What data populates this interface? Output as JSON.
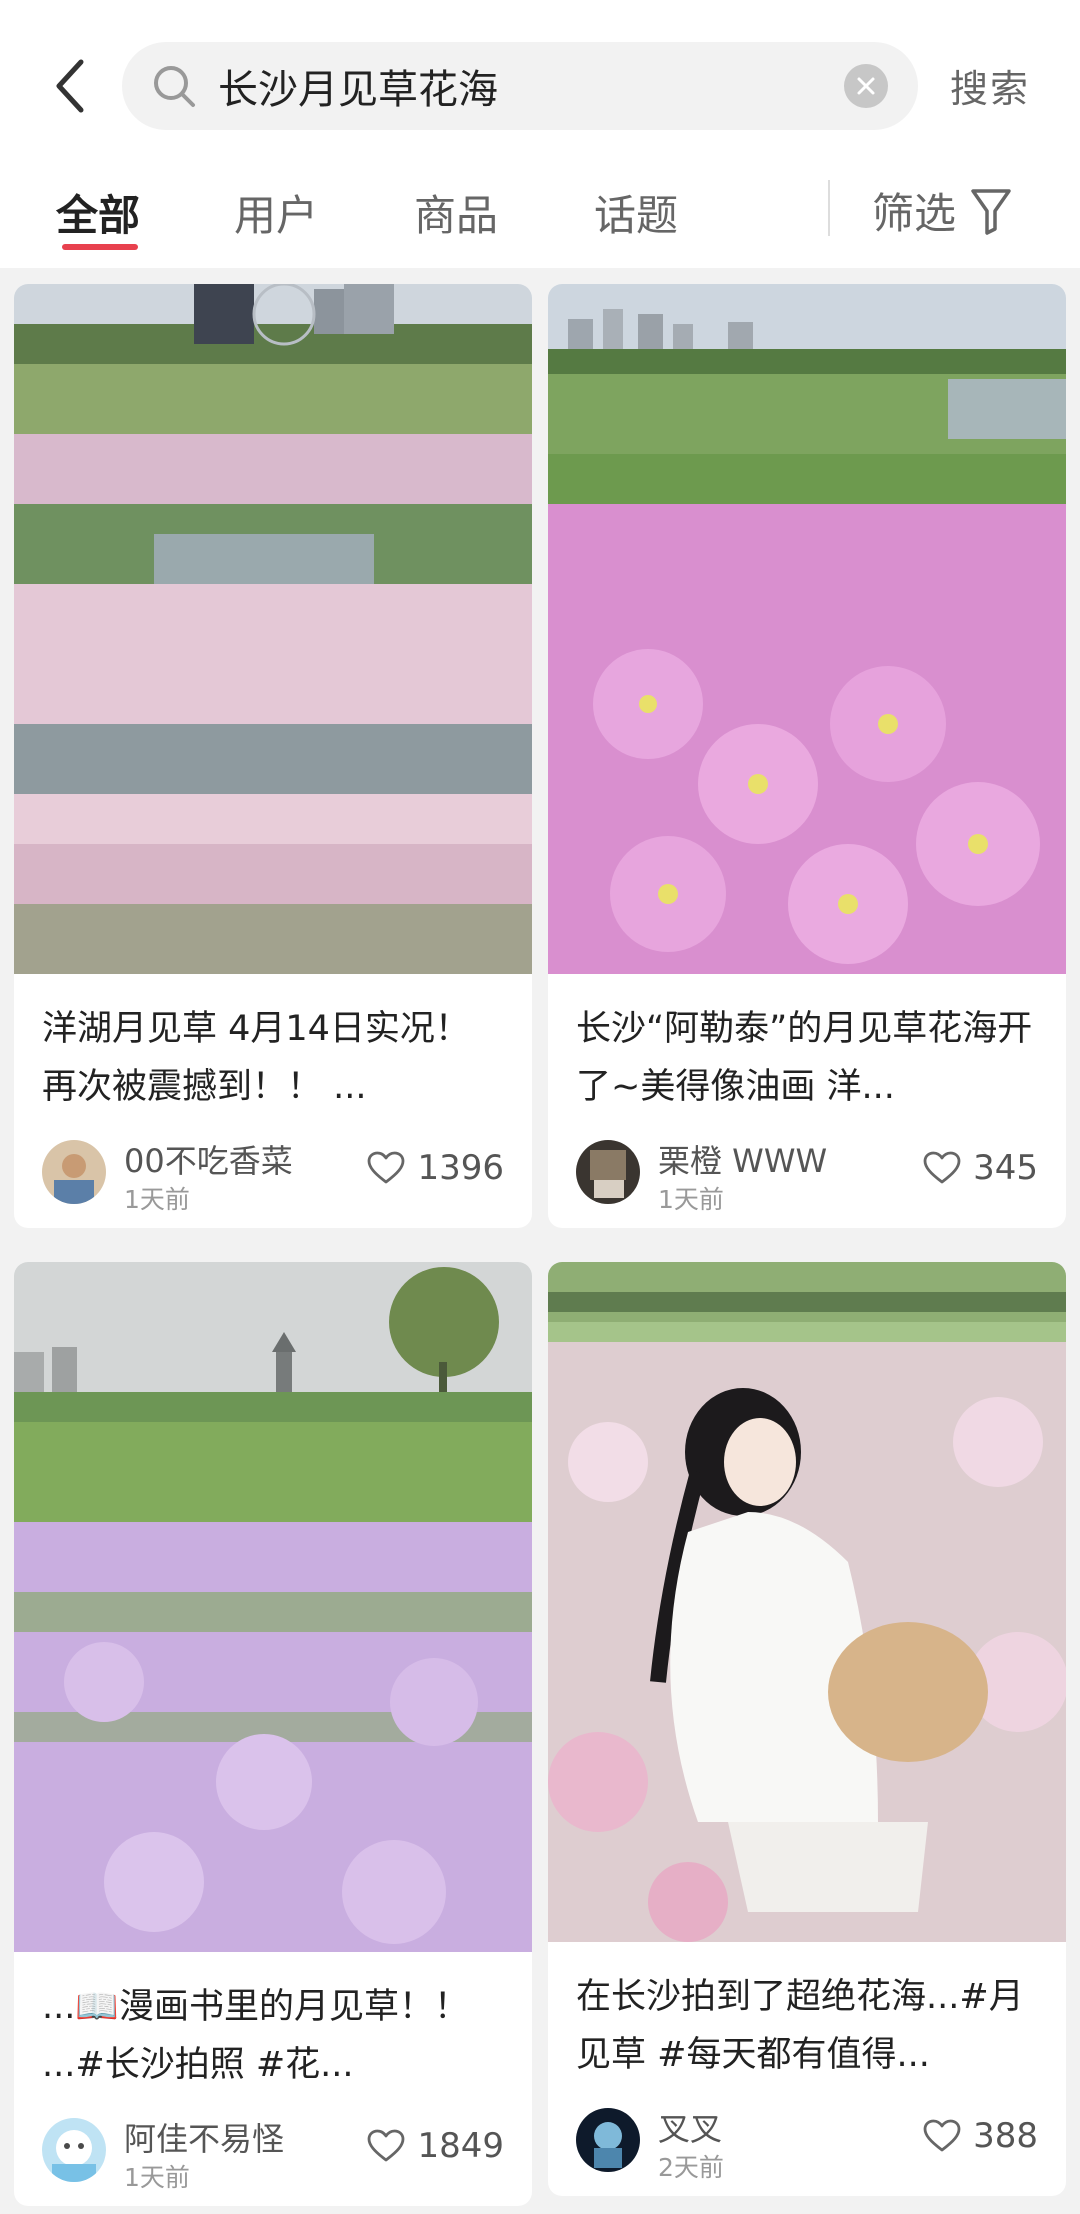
{
  "header": {
    "query": "长沙月见草花海",
    "search_label": "搜索"
  },
  "tabs": [
    {
      "label": "全部",
      "active": true
    },
    {
      "label": "用户",
      "active": false
    },
    {
      "label": "商品",
      "active": false
    },
    {
      "label": "话题",
      "active": false
    }
  ],
  "filter_label": "筛选",
  "icons": {
    "back": "chevron-left-icon",
    "search": "search-icon",
    "clear": "clear-icon",
    "filter": "funnel-icon",
    "like": "heart-icon"
  },
  "colors": {
    "accent": "#e8414e",
    "background": "#f2f2f2"
  },
  "posts": [
    {
      "title": "洋湖月见草 4月14日实况！再次被震撼到！！ ...",
      "author": "00不吃香菜",
      "time": "1天前",
      "likes": "1396"
    },
    {
      "title": "长沙“阿勒泰”的月见草花海开了~美得像油画 洋...",
      "author": "栗橙 WWW",
      "time": "1天前",
      "likes": "345"
    },
    {
      "title": "...📖漫画书里的月见草！！ ...#长沙拍照 #花...",
      "author": "阿佳不易怪",
      "time": "1天前",
      "likes": "1849"
    },
    {
      "title": "在长沙拍到了超绝花海...#月见草 #每天都有值得...",
      "author": "叉叉",
      "time": "2天前",
      "likes": "388"
    }
  ]
}
